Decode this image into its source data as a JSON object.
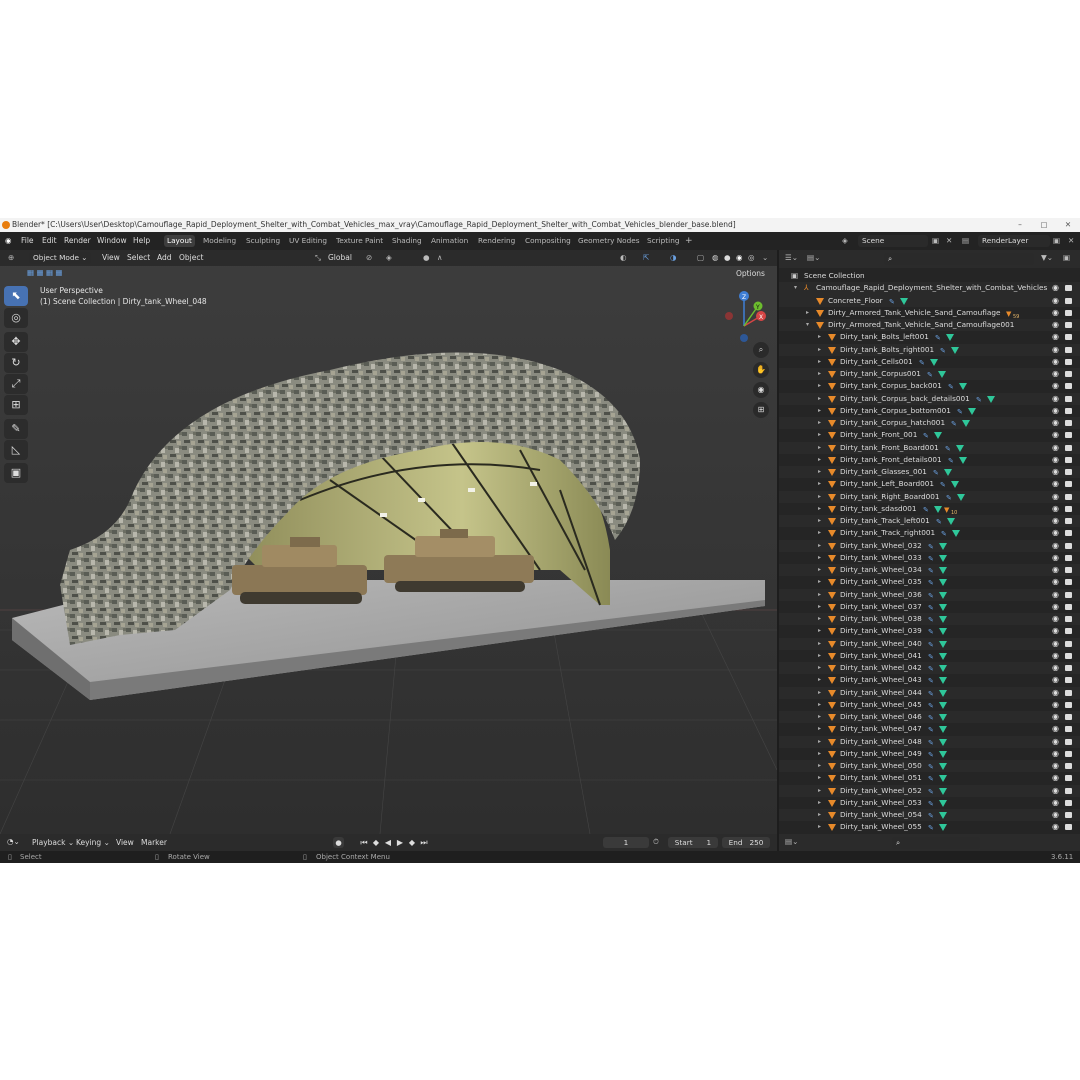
{
  "titlebar": {
    "title": "Blender* [C:\\Users\\User\\Desktop\\Camouflage_Rapid_Deployment_Shelter_with_Combat_Vehicles_max_vray\\Camouflage_Rapid_Deployment_Shelter_with_Combat_Vehicles_blender_base.blend]"
  },
  "menu": [
    "File",
    "Edit",
    "Render",
    "Window",
    "Help"
  ],
  "workspaces": [
    "Layout",
    "Modeling",
    "Sculpting",
    "UV Editing",
    "Texture Paint",
    "Shading",
    "Animation",
    "Rendering",
    "Compositing",
    "Geometry Nodes",
    "Scripting"
  ],
  "scene": {
    "label": "Scene",
    "layer": "RenderLayer"
  },
  "viewport": {
    "mode": "Object Mode",
    "menu": [
      "View",
      "Select",
      "Add",
      "Object"
    ],
    "orientation": "Global",
    "options": "Options",
    "perspective": "User Perspective",
    "collection_info": "(1) Scene Collection | Dirty_tank_Wheel_048",
    "gizmo": {
      "z": "Z",
      "y": "Y",
      "x": "X"
    }
  },
  "outliner": {
    "root": "Scene Collection",
    "collection": "Camouflage_Rapid_Deployment_Shelter_with_Combat_Vehicles",
    "items": [
      {
        "name": "Concrete_Floor",
        "level": 1,
        "expander": ""
      },
      {
        "name": "Dirty_Armored_Tank_Vehicle_Sand_Camouflage",
        "level": 1,
        "expander": "▸",
        "badge": "59"
      },
      {
        "name": "Dirty_Armored_Tank_Vehicle_Sand_Camouflage001",
        "level": 1,
        "expander": "▾"
      },
      {
        "name": "Dirty_tank_Bolts_left001",
        "level": 2,
        "expander": "▸"
      },
      {
        "name": "Dirty_tank_Bolts_right001",
        "level": 2,
        "expander": "▸"
      },
      {
        "name": "Dirty_tank_Cells001",
        "level": 2,
        "expander": "▸"
      },
      {
        "name": "Dirty_tank_Corpus001",
        "level": 2,
        "expander": "▸"
      },
      {
        "name": "Dirty_tank_Corpus_back001",
        "level": 2,
        "expander": "▸"
      },
      {
        "name": "Dirty_tank_Corpus_back_details001",
        "level": 2,
        "expander": "▸"
      },
      {
        "name": "Dirty_tank_Corpus_bottom001",
        "level": 2,
        "expander": "▸"
      },
      {
        "name": "Dirty_tank_Corpus_hatch001",
        "level": 2,
        "expander": "▸"
      },
      {
        "name": "Dirty_tank_Front_001",
        "level": 2,
        "expander": "▸"
      },
      {
        "name": "Dirty_tank_Front_Board001",
        "level": 2,
        "expander": "▸"
      },
      {
        "name": "Dirty_tank_Front_details001",
        "level": 2,
        "expander": "▸"
      },
      {
        "name": "Dirty_tank_Glasses_001",
        "level": 2,
        "expander": "▸"
      },
      {
        "name": "Dirty_tank_Left_Board001",
        "level": 2,
        "expander": "▸"
      },
      {
        "name": "Dirty_tank_Right_Board001",
        "level": 2,
        "expander": "▸"
      },
      {
        "name": "Dirty_tank_sdasd001",
        "level": 2,
        "expander": "▸",
        "badge": "10"
      },
      {
        "name": "Dirty_tank_Track_left001",
        "level": 2,
        "expander": "▸"
      },
      {
        "name": "Dirty_tank_Track_right001",
        "level": 2,
        "expander": "▸"
      },
      {
        "name": "Dirty_tank_Wheel_032",
        "level": 2,
        "expander": "▸"
      },
      {
        "name": "Dirty_tank_Wheel_033",
        "level": 2,
        "expander": "▸"
      },
      {
        "name": "Dirty_tank_Wheel_034",
        "level": 2,
        "expander": "▸"
      },
      {
        "name": "Dirty_tank_Wheel_035",
        "level": 2,
        "expander": "▸"
      },
      {
        "name": "Dirty_tank_Wheel_036",
        "level": 2,
        "expander": "▸"
      },
      {
        "name": "Dirty_tank_Wheel_037",
        "level": 2,
        "expander": "▸"
      },
      {
        "name": "Dirty_tank_Wheel_038",
        "level": 2,
        "expander": "▸"
      },
      {
        "name": "Dirty_tank_Wheel_039",
        "level": 2,
        "expander": "▸"
      },
      {
        "name": "Dirty_tank_Wheel_040",
        "level": 2,
        "expander": "▸"
      },
      {
        "name": "Dirty_tank_Wheel_041",
        "level": 2,
        "expander": "▸"
      },
      {
        "name": "Dirty_tank_Wheel_042",
        "level": 2,
        "expander": "▸"
      },
      {
        "name": "Dirty_tank_Wheel_043",
        "level": 2,
        "expander": "▸"
      },
      {
        "name": "Dirty_tank_Wheel_044",
        "level": 2,
        "expander": "▸"
      },
      {
        "name": "Dirty_tank_Wheel_045",
        "level": 2,
        "expander": "▸"
      },
      {
        "name": "Dirty_tank_Wheel_046",
        "level": 2,
        "expander": "▸"
      },
      {
        "name": "Dirty_tank_Wheel_047",
        "level": 2,
        "expander": "▸"
      },
      {
        "name": "Dirty_tank_Wheel_048",
        "level": 2,
        "expander": "▸"
      },
      {
        "name": "Dirty_tank_Wheel_049",
        "level": 2,
        "expander": "▸"
      },
      {
        "name": "Dirty_tank_Wheel_050",
        "level": 2,
        "expander": "▸"
      },
      {
        "name": "Dirty_tank_Wheel_051",
        "level": 2,
        "expander": "▸"
      },
      {
        "name": "Dirty_tank_Wheel_052",
        "level": 2,
        "expander": "▸"
      },
      {
        "name": "Dirty_tank_Wheel_053",
        "level": 2,
        "expander": "▸"
      },
      {
        "name": "Dirty_tank_Wheel_054",
        "level": 2,
        "expander": "▸"
      },
      {
        "name": "Dirty_tank_Wheel_055",
        "level": 2,
        "expander": "▸"
      }
    ]
  },
  "timeline": {
    "menu": [
      "Playback",
      "Keying",
      "View",
      "Marker"
    ],
    "current_frame": "1",
    "start_label": "Start",
    "start": "1",
    "end_label": "End",
    "end": "250"
  },
  "status": {
    "select": "Select",
    "rotate": "Rotate View",
    "context": "Object Context Menu",
    "version": "3.6.11"
  },
  "colors": {
    "accent": "#4772b3",
    "object_icon": "#e88a2a",
    "mesh_icon": "#2fc79a",
    "bg": "#1d1d1d"
  }
}
